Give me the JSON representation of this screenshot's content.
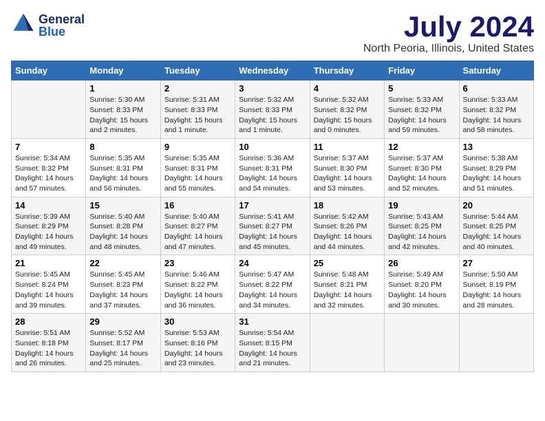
{
  "header": {
    "logo_general": "General",
    "logo_blue": "Blue",
    "main_title": "July 2024",
    "subtitle": "North Peoria, Illinois, United States"
  },
  "calendar": {
    "days_of_week": [
      "Sunday",
      "Monday",
      "Tuesday",
      "Wednesday",
      "Thursday",
      "Friday",
      "Saturday"
    ],
    "weeks": [
      [
        {
          "day": "",
          "info": ""
        },
        {
          "day": "1",
          "info": "Sunrise: 5:30 AM\nSunset: 8:33 PM\nDaylight: 15 hours\nand 2 minutes."
        },
        {
          "day": "2",
          "info": "Sunrise: 5:31 AM\nSunset: 8:33 PM\nDaylight: 15 hours\nand 1 minute."
        },
        {
          "day": "3",
          "info": "Sunrise: 5:32 AM\nSunset: 8:33 PM\nDaylight: 15 hours\nand 1 minute."
        },
        {
          "day": "4",
          "info": "Sunrise: 5:32 AM\nSunset: 8:32 PM\nDaylight: 15 hours\nand 0 minutes."
        },
        {
          "day": "5",
          "info": "Sunrise: 5:33 AM\nSunset: 8:32 PM\nDaylight: 14 hours\nand 59 minutes."
        },
        {
          "day": "6",
          "info": "Sunrise: 5:33 AM\nSunset: 8:32 PM\nDaylight: 14 hours\nand 58 minutes."
        }
      ],
      [
        {
          "day": "7",
          "info": "Sunrise: 5:34 AM\nSunset: 8:32 PM\nDaylight: 14 hours\nand 57 minutes."
        },
        {
          "day": "8",
          "info": "Sunrise: 5:35 AM\nSunset: 8:31 PM\nDaylight: 14 hours\nand 56 minutes."
        },
        {
          "day": "9",
          "info": "Sunrise: 5:35 AM\nSunset: 8:31 PM\nDaylight: 14 hours\nand 55 minutes."
        },
        {
          "day": "10",
          "info": "Sunrise: 5:36 AM\nSunset: 8:31 PM\nDaylight: 14 hours\nand 54 minutes."
        },
        {
          "day": "11",
          "info": "Sunrise: 5:37 AM\nSunset: 8:30 PM\nDaylight: 14 hours\nand 53 minutes."
        },
        {
          "day": "12",
          "info": "Sunrise: 5:37 AM\nSunset: 8:30 PM\nDaylight: 14 hours\nand 52 minutes."
        },
        {
          "day": "13",
          "info": "Sunrise: 5:38 AM\nSunset: 8:29 PM\nDaylight: 14 hours\nand 51 minutes."
        }
      ],
      [
        {
          "day": "14",
          "info": "Sunrise: 5:39 AM\nSunset: 8:29 PM\nDaylight: 14 hours\nand 49 minutes."
        },
        {
          "day": "15",
          "info": "Sunrise: 5:40 AM\nSunset: 8:28 PM\nDaylight: 14 hours\nand 48 minutes."
        },
        {
          "day": "16",
          "info": "Sunrise: 5:40 AM\nSunset: 8:27 PM\nDaylight: 14 hours\nand 47 minutes."
        },
        {
          "day": "17",
          "info": "Sunrise: 5:41 AM\nSunset: 8:27 PM\nDaylight: 14 hours\nand 45 minutes."
        },
        {
          "day": "18",
          "info": "Sunrise: 5:42 AM\nSunset: 8:26 PM\nDaylight: 14 hours\nand 44 minutes."
        },
        {
          "day": "19",
          "info": "Sunrise: 5:43 AM\nSunset: 8:25 PM\nDaylight: 14 hours\nand 42 minutes."
        },
        {
          "day": "20",
          "info": "Sunrise: 5:44 AM\nSunset: 8:25 PM\nDaylight: 14 hours\nand 40 minutes."
        }
      ],
      [
        {
          "day": "21",
          "info": "Sunrise: 5:45 AM\nSunset: 8:24 PM\nDaylight: 14 hours\nand 39 minutes."
        },
        {
          "day": "22",
          "info": "Sunrise: 5:45 AM\nSunset: 8:23 PM\nDaylight: 14 hours\nand 37 minutes."
        },
        {
          "day": "23",
          "info": "Sunrise: 5:46 AM\nSunset: 8:22 PM\nDaylight: 14 hours\nand 36 minutes."
        },
        {
          "day": "24",
          "info": "Sunrise: 5:47 AM\nSunset: 8:22 PM\nDaylight: 14 hours\nand 34 minutes."
        },
        {
          "day": "25",
          "info": "Sunrise: 5:48 AM\nSunset: 8:21 PM\nDaylight: 14 hours\nand 32 minutes."
        },
        {
          "day": "26",
          "info": "Sunrise: 5:49 AM\nSunset: 8:20 PM\nDaylight: 14 hours\nand 30 minutes."
        },
        {
          "day": "27",
          "info": "Sunrise: 5:50 AM\nSunset: 8:19 PM\nDaylight: 14 hours\nand 28 minutes."
        }
      ],
      [
        {
          "day": "28",
          "info": "Sunrise: 5:51 AM\nSunset: 8:18 PM\nDaylight: 14 hours\nand 26 minutes."
        },
        {
          "day": "29",
          "info": "Sunrise: 5:52 AM\nSunset: 8:17 PM\nDaylight: 14 hours\nand 25 minutes."
        },
        {
          "day": "30",
          "info": "Sunrise: 5:53 AM\nSunset: 8:16 PM\nDaylight: 14 hours\nand 23 minutes."
        },
        {
          "day": "31",
          "info": "Sunrise: 5:54 AM\nSunset: 8:15 PM\nDaylight: 14 hours\nand 21 minutes."
        },
        {
          "day": "",
          "info": ""
        },
        {
          "day": "",
          "info": ""
        },
        {
          "day": "",
          "info": ""
        }
      ]
    ]
  }
}
